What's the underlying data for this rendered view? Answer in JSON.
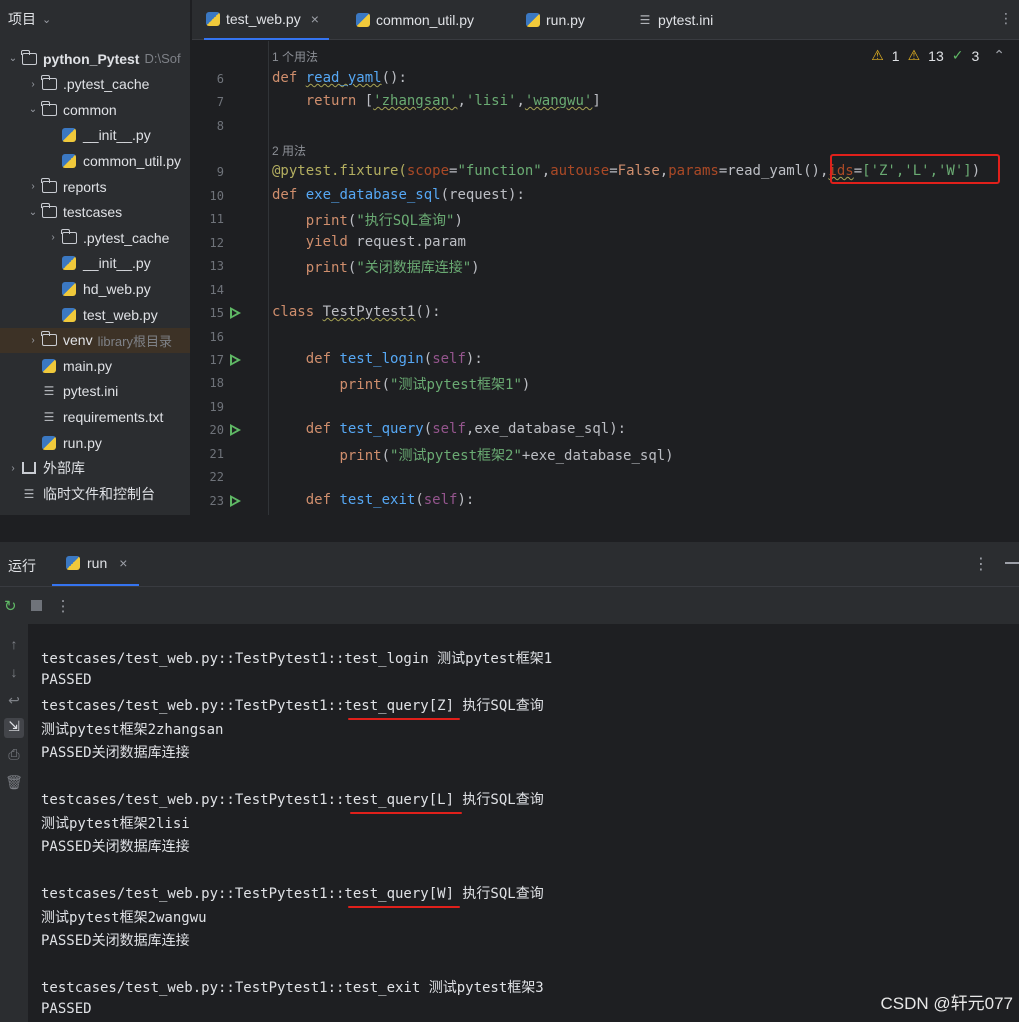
{
  "sidebar": {
    "title": "项目",
    "tree": [
      {
        "label": "python_Pytest",
        "extra": "D:\\Sof",
        "type": "folder",
        "depth": 0,
        "open": true
      },
      {
        "label": ".pytest_cache",
        "type": "folder",
        "depth": 1,
        "open": false
      },
      {
        "label": "common",
        "type": "folder",
        "depth": 1,
        "open": true
      },
      {
        "label": "__init__.py",
        "type": "py",
        "depth": 2
      },
      {
        "label": "common_util.py",
        "type": "py",
        "depth": 2
      },
      {
        "label": "reports",
        "type": "folder",
        "depth": 1,
        "open": false
      },
      {
        "label": "testcases",
        "type": "folder",
        "depth": 1,
        "open": true
      },
      {
        "label": ".pytest_cache",
        "type": "folder",
        "depth": 2,
        "open": false
      },
      {
        "label": "__init__.py",
        "type": "py",
        "depth": 2
      },
      {
        "label": "hd_web.py",
        "type": "py",
        "depth": 2
      },
      {
        "label": "test_web.py",
        "type": "py",
        "depth": 2
      },
      {
        "label": "venv",
        "extra": "library根目录",
        "type": "folder",
        "depth": 1,
        "open": false,
        "highlight": true
      },
      {
        "label": "main.py",
        "type": "py",
        "depth": 1
      },
      {
        "label": "pytest.ini",
        "type": "ini",
        "depth": 1
      },
      {
        "label": "requirements.txt",
        "type": "ini",
        "depth": 1
      },
      {
        "label": "run.py",
        "type": "py",
        "depth": 1
      },
      {
        "label": "外部库",
        "type": "lib",
        "depth": 0,
        "open": false
      },
      {
        "label": "临时文件和控制台",
        "type": "scratch",
        "depth": 0
      }
    ]
  },
  "tabs": [
    {
      "label": "test_web.py",
      "active": true,
      "icon": "python-icon"
    },
    {
      "label": "common_util.py",
      "active": false,
      "icon": "python-icon"
    },
    {
      "label": "run.py",
      "active": false,
      "icon": "python-icon"
    },
    {
      "label": "pytest.ini",
      "active": false,
      "icon": "ini-icon"
    }
  ],
  "inspections": {
    "warnings": "1",
    "weak_warnings": "13",
    "ok": "3"
  },
  "editor": {
    "usage1": "1 个用法",
    "usage2": "2 用法",
    "line_numbers": [
      "6",
      "7",
      "8",
      "9",
      "10",
      "11",
      "12",
      "13",
      "14",
      "15",
      "16",
      "17",
      "18",
      "19",
      "20",
      "21",
      "22",
      "23"
    ]
  },
  "code": {
    "l6_kw": "def",
    "l6_fn": "read_yaml",
    "l6_rest": "():",
    "l7_kw": "return",
    "l7_a": " [",
    "l7_s1": "'zhangsan'",
    "l7_s2": "'lisi'",
    "l7_s3": "'wangwu'",
    "l7_b": "]",
    "l9_dec": "@pytest.fixture(",
    "l9_p1": "scope",
    "l9_s1": "\"function\"",
    "l9_p2": "autouse",
    "l9_v2": "False",
    "l9_p3": "params",
    "l9_v3": "=read_yaml()",
    "l9_p4": "ids",
    "l9_ids": "['Z','L','W']",
    "l9_end": ")",
    "l10_kw": "def",
    "l10_fn": "exe_database_sql",
    "l10_rest": "(request):",
    "l11_fn": "print",
    "l11_s": "\"执行SQL查询\"",
    "l12_kw": "yield",
    "l12_rest": " request.param",
    "l13_fn": "print",
    "l13_s": "\"关闭数据库连接\"",
    "l15_kw": "class",
    "l15_cls": "TestPytest1",
    "l15_rest": "():",
    "l17_kw": "def",
    "l17_fn": "test_login",
    "l17_self": "self",
    "l18_fn": "print",
    "l18_s": "\"测试pytest框架1\"",
    "l20_kw": "def",
    "l20_fn": "test_query",
    "l20_self": "self",
    "l20_rest": "exe_database_sql):",
    "l21_fn": "print",
    "l21_s": "\"测试pytest框架2\"",
    "l21_rest": "+exe_database_sql)",
    "l23_kw": "def",
    "l23_fn": "test_exit",
    "l23_self": "self"
  },
  "run_panel": {
    "title": "运行",
    "tab": "run",
    "console": [
      "testcases/test_web.py::TestPytest1::test_login 测试pytest框架1",
      "PASSED",
      "testcases/test_web.py::TestPytest1::test_query[Z] 执行SQL查询",
      "测试pytest框架2zhangsan",
      "PASSED关闭数据库连接",
      "",
      "testcases/test_web.py::TestPytest1::test_query[L] 执行SQL查询",
      "测试pytest框架2lisi",
      "PASSED关闭数据库连接",
      "",
      "testcases/test_web.py::TestPytest1::test_query[W] 执行SQL查询",
      "测试pytest框架2wangwu",
      "PASSED关闭数据库连接",
      "",
      "testcases/test_web.py::TestPytest1::test_exit 测试pytest框架3",
      "PASSED"
    ]
  },
  "watermark": "CSDN @轩元077"
}
